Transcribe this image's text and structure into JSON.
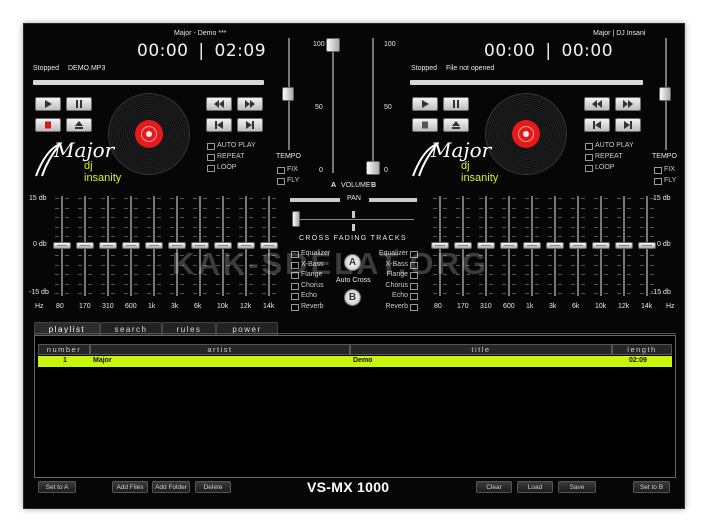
{
  "deckA": {
    "title": "Major - Demo ***",
    "time_elapsed": "00:00",
    "time_total": "02:09",
    "status": "Stopped",
    "file": "DEMO.MP3",
    "options": [
      "AUTO PLAY",
      "REPEAT",
      "LOOP"
    ],
    "tempo_label": "TEMPO",
    "tempo_options": [
      "FIX",
      "FLY"
    ]
  },
  "deckB": {
    "title": "Major | DJ Insani",
    "time_elapsed": "00:00",
    "time_total": "00:00",
    "status": "Stopped",
    "file": "File not opened",
    "options": [
      "AUTO PLAY",
      "REPEAT",
      "LOOP"
    ],
    "tempo_label": "TEMPO",
    "tempo_options": [
      "FIX",
      "FLY"
    ]
  },
  "logo": {
    "main": "Major",
    "sub": "dj insanity"
  },
  "volume": {
    "label": "VOLUME",
    "a": "A",
    "b": "B",
    "scale": [
      "100",
      "50",
      "0"
    ]
  },
  "pan_label": "PAN",
  "crossfade_label": "CROSS FADING TRACKS",
  "effects": [
    "Equalizer",
    "X-Bass",
    "Flange",
    "Chorus",
    "Echo",
    "Reverb"
  ],
  "auto_cross": {
    "label": "Auto Cross",
    "a": "A",
    "b": "B"
  },
  "eq": {
    "db_labels": [
      "15 db",
      "0 db",
      "-15 db"
    ],
    "hz_label": "Hz",
    "bands": [
      "80",
      "170",
      "310",
      "600",
      "1k",
      "3k",
      "6k",
      "10k",
      "12k",
      "14k"
    ]
  },
  "tabs": [
    "playlist",
    "search",
    "rules",
    "power"
  ],
  "playlist": {
    "columns": [
      "number",
      "artist",
      "title",
      "length"
    ],
    "rows": [
      {
        "number": "1",
        "artist": "Major",
        "title": "Demo",
        "length": "02:09"
      }
    ]
  },
  "bottom": {
    "set_a": "Set to A",
    "add_files": "Add Files",
    "add_folder": "Add Folder",
    "delete": "Delete",
    "brand": "VS-MX 1000",
    "clear": "Clear",
    "load": "Load",
    "save": "Save",
    "set_b": "Set to B"
  },
  "watermark": "KAK-SDELAT.ORG",
  "icons": [
    "play-icon",
    "pause-icon",
    "stop-icon",
    "eject-icon",
    "rewind-icon",
    "fast-forward-icon",
    "skip-back-icon",
    "skip-forward-icon"
  ],
  "colors": {
    "accent": "#c8f50c",
    "vinyl_label": "#e51b1b",
    "background": "#060606"
  }
}
